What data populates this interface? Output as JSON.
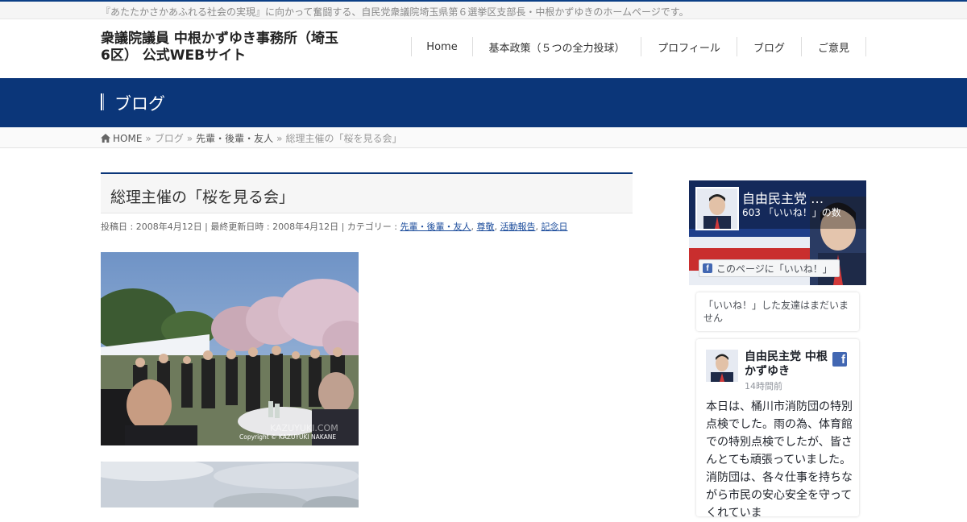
{
  "header": {
    "tagline": "『あたたかさかあふれる社会の実現』に向かって奮闘する、自民党衆議院埼玉県第６選挙区支部長・中根かずゆきのホームページです。",
    "site_title": "衆議院議員 中根かずゆき事務所（埼玉6区） 公式WEBサイト"
  },
  "nav": {
    "items": [
      {
        "label": "Home"
      },
      {
        "label": "基本政策（５つの全力投球）"
      },
      {
        "label": "プロフィール"
      },
      {
        "label": "ブログ"
      },
      {
        "label": "ご意見"
      }
    ]
  },
  "banner": {
    "title": "ブログ"
  },
  "breadcrumb": {
    "home": "HOME",
    "sep": "»",
    "blog": "ブログ",
    "category": "先輩・後輩・友人",
    "current": "総理主催の「桜を見る会」"
  },
  "post": {
    "title": "総理主催の「桜を見る会」",
    "meta_prefix": "投稿日 : 2008年4月12日 | 最終更新日時 : 2008年4月12日 | カテゴリー : ",
    "categories": [
      "先輩・後輩・友人",
      "尊敬",
      "活動報告",
      "記念日"
    ],
    "category_sep": ", ",
    "photo_watermark": "KAZUYUKI.COM",
    "photo_copyright": "Copyright © KAZUYUKI NAKANE"
  },
  "facebook": {
    "page_name": "自由民主党 …",
    "like_count": "603 「いいね！」の数",
    "like_button": "このページに「いいね！」",
    "friends_text": "「いいね！」した友達はまだいません",
    "post_author": "自由民主党 中根かずゆき",
    "post_time": "14時間前",
    "post_text": "本日は、桶川市消防団の特別点検でした。雨の為、体育館での特別点検でしたが、皆さんとても頑張っていました。消防団は、各々仕事を持ちながら市民の安心安全を守ってくれていま"
  },
  "colors": {
    "brand_navy": "#0b3679",
    "link_blue": "#1a4b9b",
    "fb_blue": "#4267b2"
  },
  "icons": {
    "home": "home-icon",
    "facebook": "facebook-icon"
  }
}
